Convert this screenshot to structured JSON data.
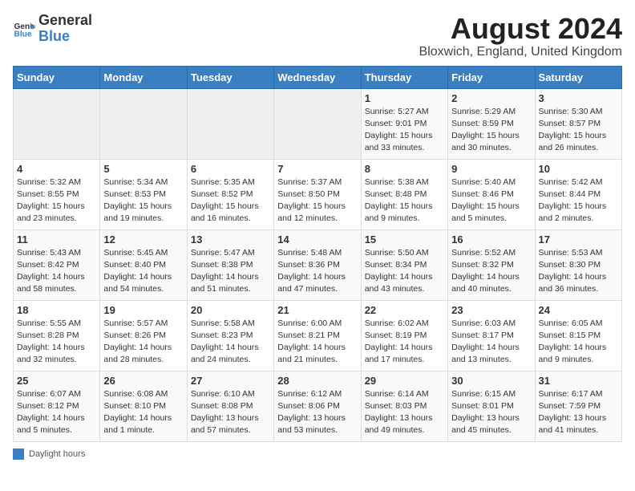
{
  "logo": {
    "general": "General",
    "blue": "Blue"
  },
  "title": "August 2024",
  "subtitle": "Bloxwich, England, United Kingdom",
  "days_of_week": [
    "Sunday",
    "Monday",
    "Tuesday",
    "Wednesday",
    "Thursday",
    "Friday",
    "Saturday"
  ],
  "footer": {
    "label": "Daylight hours"
  },
  "weeks": [
    [
      {
        "day": "",
        "info": ""
      },
      {
        "day": "",
        "info": ""
      },
      {
        "day": "",
        "info": ""
      },
      {
        "day": "",
        "info": ""
      },
      {
        "day": "1",
        "info": "Sunrise: 5:27 AM\nSunset: 9:01 PM\nDaylight: 15 hours\nand 33 minutes."
      },
      {
        "day": "2",
        "info": "Sunrise: 5:29 AM\nSunset: 8:59 PM\nDaylight: 15 hours\nand 30 minutes."
      },
      {
        "day": "3",
        "info": "Sunrise: 5:30 AM\nSunset: 8:57 PM\nDaylight: 15 hours\nand 26 minutes."
      }
    ],
    [
      {
        "day": "4",
        "info": "Sunrise: 5:32 AM\nSunset: 8:55 PM\nDaylight: 15 hours\nand 23 minutes."
      },
      {
        "day": "5",
        "info": "Sunrise: 5:34 AM\nSunset: 8:53 PM\nDaylight: 15 hours\nand 19 minutes."
      },
      {
        "day": "6",
        "info": "Sunrise: 5:35 AM\nSunset: 8:52 PM\nDaylight: 15 hours\nand 16 minutes."
      },
      {
        "day": "7",
        "info": "Sunrise: 5:37 AM\nSunset: 8:50 PM\nDaylight: 15 hours\nand 12 minutes."
      },
      {
        "day": "8",
        "info": "Sunrise: 5:38 AM\nSunset: 8:48 PM\nDaylight: 15 hours\nand 9 minutes."
      },
      {
        "day": "9",
        "info": "Sunrise: 5:40 AM\nSunset: 8:46 PM\nDaylight: 15 hours\nand 5 minutes."
      },
      {
        "day": "10",
        "info": "Sunrise: 5:42 AM\nSunset: 8:44 PM\nDaylight: 15 hours\nand 2 minutes."
      }
    ],
    [
      {
        "day": "11",
        "info": "Sunrise: 5:43 AM\nSunset: 8:42 PM\nDaylight: 14 hours\nand 58 minutes."
      },
      {
        "day": "12",
        "info": "Sunrise: 5:45 AM\nSunset: 8:40 PM\nDaylight: 14 hours\nand 54 minutes."
      },
      {
        "day": "13",
        "info": "Sunrise: 5:47 AM\nSunset: 8:38 PM\nDaylight: 14 hours\nand 51 minutes."
      },
      {
        "day": "14",
        "info": "Sunrise: 5:48 AM\nSunset: 8:36 PM\nDaylight: 14 hours\nand 47 minutes."
      },
      {
        "day": "15",
        "info": "Sunrise: 5:50 AM\nSunset: 8:34 PM\nDaylight: 14 hours\nand 43 minutes."
      },
      {
        "day": "16",
        "info": "Sunrise: 5:52 AM\nSunset: 8:32 PM\nDaylight: 14 hours\nand 40 minutes."
      },
      {
        "day": "17",
        "info": "Sunrise: 5:53 AM\nSunset: 8:30 PM\nDaylight: 14 hours\nand 36 minutes."
      }
    ],
    [
      {
        "day": "18",
        "info": "Sunrise: 5:55 AM\nSunset: 8:28 PM\nDaylight: 14 hours\nand 32 minutes."
      },
      {
        "day": "19",
        "info": "Sunrise: 5:57 AM\nSunset: 8:26 PM\nDaylight: 14 hours\nand 28 minutes."
      },
      {
        "day": "20",
        "info": "Sunrise: 5:58 AM\nSunset: 8:23 PM\nDaylight: 14 hours\nand 24 minutes."
      },
      {
        "day": "21",
        "info": "Sunrise: 6:00 AM\nSunset: 8:21 PM\nDaylight: 14 hours\nand 21 minutes."
      },
      {
        "day": "22",
        "info": "Sunrise: 6:02 AM\nSunset: 8:19 PM\nDaylight: 14 hours\nand 17 minutes."
      },
      {
        "day": "23",
        "info": "Sunrise: 6:03 AM\nSunset: 8:17 PM\nDaylight: 14 hours\nand 13 minutes."
      },
      {
        "day": "24",
        "info": "Sunrise: 6:05 AM\nSunset: 8:15 PM\nDaylight: 14 hours\nand 9 minutes."
      }
    ],
    [
      {
        "day": "25",
        "info": "Sunrise: 6:07 AM\nSunset: 8:12 PM\nDaylight: 14 hours\nand 5 minutes."
      },
      {
        "day": "26",
        "info": "Sunrise: 6:08 AM\nSunset: 8:10 PM\nDaylight: 14 hours\nand 1 minute."
      },
      {
        "day": "27",
        "info": "Sunrise: 6:10 AM\nSunset: 8:08 PM\nDaylight: 13 hours\nand 57 minutes."
      },
      {
        "day": "28",
        "info": "Sunrise: 6:12 AM\nSunset: 8:06 PM\nDaylight: 13 hours\nand 53 minutes."
      },
      {
        "day": "29",
        "info": "Sunrise: 6:14 AM\nSunset: 8:03 PM\nDaylight: 13 hours\nand 49 minutes."
      },
      {
        "day": "30",
        "info": "Sunrise: 6:15 AM\nSunset: 8:01 PM\nDaylight: 13 hours\nand 45 minutes."
      },
      {
        "day": "31",
        "info": "Sunrise: 6:17 AM\nSunset: 7:59 PM\nDaylight: 13 hours\nand 41 minutes."
      }
    ]
  ]
}
